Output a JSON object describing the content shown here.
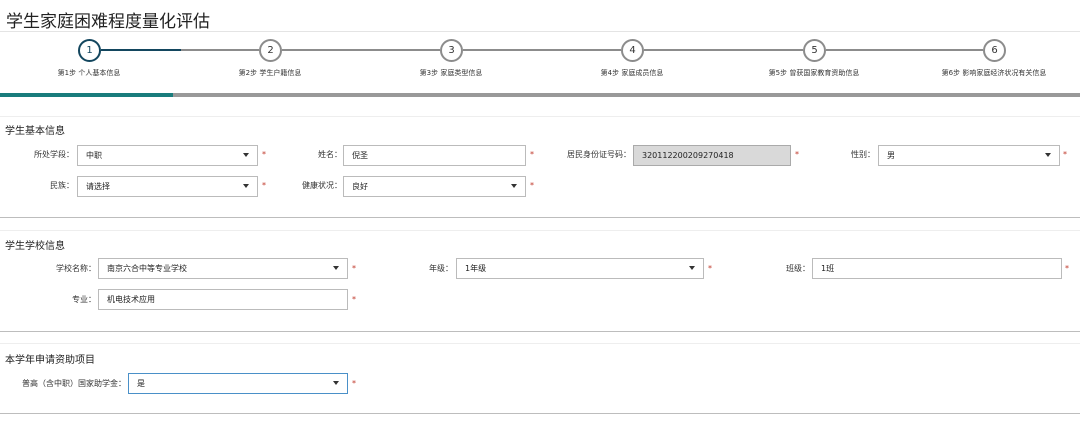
{
  "page": {
    "title": "学生家庭困难程度量化评估"
  },
  "wizard": {
    "steps": [
      {
        "number": "1",
        "label": "第1步 个人基本信息"
      },
      {
        "number": "2",
        "label": "第2步 学生户籍信息"
      },
      {
        "number": "3",
        "label": "第3步 家庭类型信息"
      },
      {
        "number": "4",
        "label": "第4步 家庭成员信息"
      },
      {
        "number": "5",
        "label": "第5步 曾获国家教育资助信息"
      },
      {
        "number": "6",
        "label": "第6步 影响家庭经济状况有关信息"
      }
    ],
    "current_step": 1,
    "progress_fraction": 0.16,
    "colors": {
      "active": "#13465e",
      "inactive": "#8c8c8c",
      "progress": "#197c7c",
      "track": "#999999"
    }
  },
  "basic_info": {
    "title": "学生基本信息",
    "stage": {
      "label": "所处学段：",
      "value": "中职"
    },
    "name": {
      "label": "姓名：",
      "value": "倪圣"
    },
    "id_card": {
      "label": "居民身份证号码：",
      "value": "320112200209270418"
    },
    "gender": {
      "label": "性别：",
      "value": "男"
    },
    "ethnicity": {
      "label": "民族：",
      "value": "请选择"
    },
    "health": {
      "label": "健康状况：",
      "value": "良好"
    }
  },
  "school_info": {
    "title": "学生学校信息",
    "school": {
      "label": "学校名称：",
      "value": "南京六合中等专业学校"
    },
    "grade": {
      "label": "年级：",
      "value": "1年级"
    },
    "class": {
      "label": "班级：",
      "value": "1班"
    },
    "major": {
      "label": "专业：",
      "value": "机电技术应用"
    }
  },
  "aid_info": {
    "title": "本学年申请资助项目",
    "scholarship": {
      "label": "普高（含中职）国家助学金：",
      "value": "是"
    }
  },
  "required_mark": "*"
}
